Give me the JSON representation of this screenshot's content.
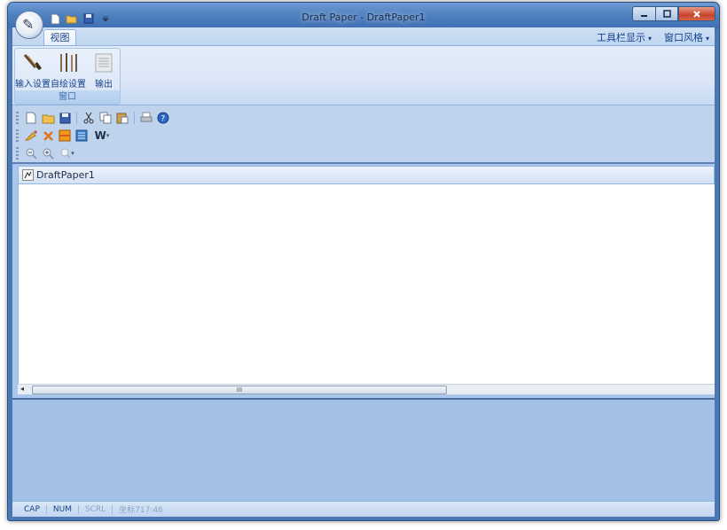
{
  "window": {
    "title": "Draft Paper - DraftPaper1",
    "caption_buttons": [
      "minimize",
      "maximize",
      "close"
    ]
  },
  "app_menu": {
    "logo_glyph": "✎"
  },
  "quick_access": {
    "icons": [
      "new-file-icon",
      "open-folder-icon",
      "save-icon",
      "customize-dropdown-icon"
    ]
  },
  "ribbon": {
    "tabs": [
      {
        "label": "视图",
        "active": true
      }
    ],
    "right_menus": [
      {
        "label": "工具栏显示"
      },
      {
        "label": "窗口风格"
      }
    ],
    "groups": [
      {
        "label": "窗口",
        "buttons": [
          {
            "label": "输入设置",
            "icon": "brush-icon"
          },
          {
            "label": "自绘设置",
            "icon": "pens-icon"
          },
          {
            "label": "输出",
            "icon": "paper-output-icon"
          }
        ]
      }
    ]
  },
  "toolbars": {
    "standard": [
      "new-icon",
      "open-icon",
      "save-icon",
      "cut-icon",
      "copy-icon",
      "paste-icon",
      "print-icon",
      "help-icon"
    ],
    "drawing": [
      "brush-icon",
      "delete-icon",
      "fill-icon",
      "layout-icon"
    ],
    "drawing_font_label": "W",
    "zoom": [
      "zoom-out-icon",
      "zoom-in-icon",
      "zoom-dropdown-icon"
    ]
  },
  "document": {
    "tab_label": "DraftPaper1",
    "scroll_grip": "III"
  },
  "statusbar": {
    "cap": "CAP",
    "num": "NUM",
    "scrl": "SCRL",
    "coordinates": "坐标717:46"
  },
  "colors": {
    "frame": "#4a78b5",
    "ribbon_text": "#15428b",
    "client": "#bfd3ec",
    "lower_area": "#a3c1e6"
  }
}
